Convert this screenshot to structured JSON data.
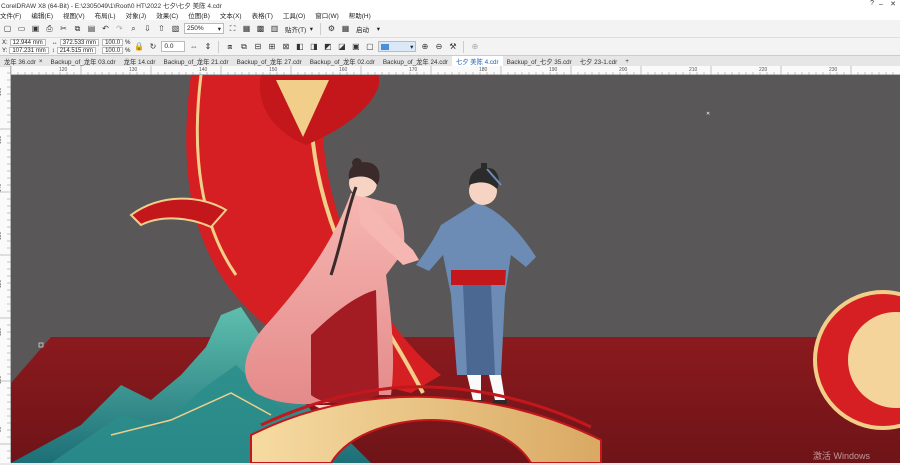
{
  "titlebar": {
    "text": "CorelDRAW X8 (64-Bit) - E:\\2305049\\1\\Root\\0 HT\\2022 七夕\\七夕 美陈 4.cdr",
    "help": "?",
    "minimize": "–",
    "close": "✕"
  },
  "menu": [
    "文件(F)",
    "编辑(E)",
    "视图(V)",
    "布局(L)",
    "对象(J)",
    "效果(C)",
    "位图(B)",
    "文本(X)",
    "表格(T)",
    "工具(O)",
    "窗口(W)",
    "帮助(H)"
  ],
  "toolbar": {
    "zoom": "250%",
    "snap_label": "贴齐(T)",
    "launch_label": "启动"
  },
  "properties": {
    "x_label": "X:",
    "x_value": "12.944 mm",
    "y_label": "Y:",
    "y_value": "107.231 mm",
    "w_value": "372.533 mm",
    "h_value": "214.515 mm",
    "scale_w": "100.0",
    "scale_h": "100.0",
    "percent": "%",
    "rotation": "0.0",
    "outline_unit": "",
    "lock_icon": "lock-icon"
  },
  "tabs": [
    {
      "label": "龙年 36.cdr",
      "active": false,
      "closable": true
    },
    {
      "label": "Backup_of_龙年 03.cdr",
      "active": false
    },
    {
      "label": "龙年 14.cdr",
      "active": false
    },
    {
      "label": "Backup_of_龙年 21.cdr",
      "active": false
    },
    {
      "label": "Backup_of_龙年 27.cdr",
      "active": false
    },
    {
      "label": "Backup_of_龙年 02.cdr",
      "active": false
    },
    {
      "label": "Backup_of_龙年 24.cdr",
      "active": false
    },
    {
      "label": "七夕 美陈 4.cdr",
      "active": true
    },
    {
      "label": "Backup_of_七夕 35.cdr",
      "active": false
    },
    {
      "label": "七夕 23-1.cdr",
      "active": false
    }
  ],
  "ruler_top": [
    "120",
    "130",
    "140",
    "150",
    "160",
    "170",
    "180",
    "190",
    "200",
    "210",
    "220",
    "230"
  ],
  "ruler_left": [
    "160",
    "150",
    "140",
    "130",
    "120",
    "110",
    "100",
    "90"
  ],
  "watermark": "激活 Windows"
}
